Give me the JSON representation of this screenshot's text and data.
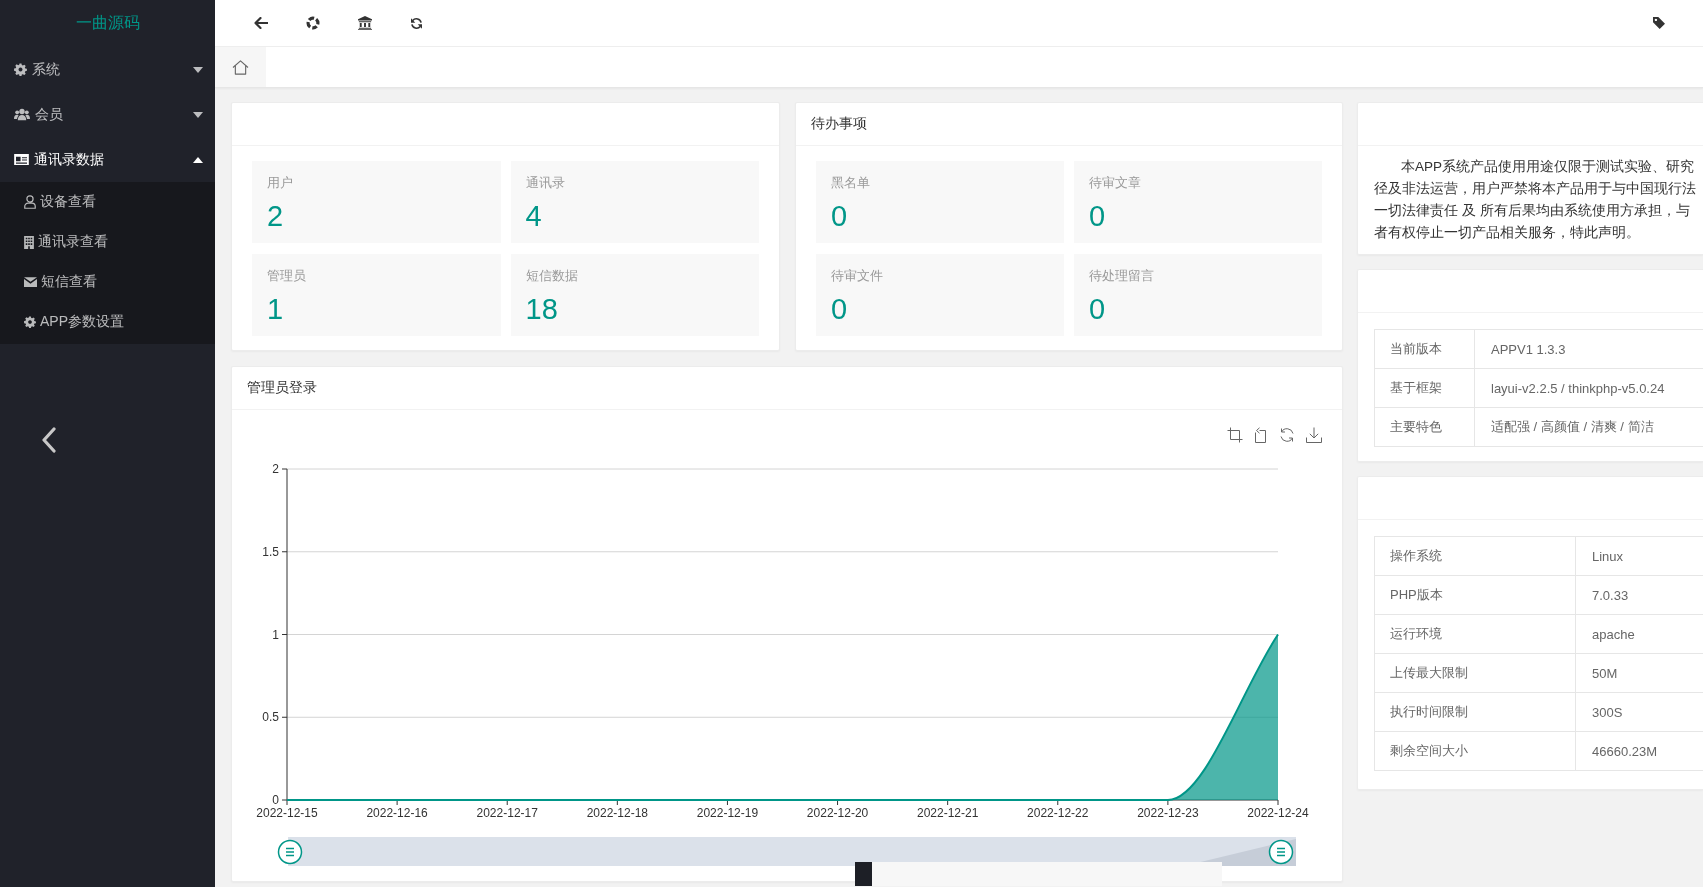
{
  "sidebar": {
    "logo": "一曲源码",
    "items": [
      {
        "label": "系统",
        "expanded": false
      },
      {
        "label": "会员",
        "expanded": false
      },
      {
        "label": "通讯录数据",
        "expanded": true,
        "children": [
          {
            "label": "设备查看"
          },
          {
            "label": "通讯录查看"
          },
          {
            "label": "短信查看"
          },
          {
            "label": "APP参数设置"
          }
        ]
      }
    ]
  },
  "overview": {
    "stats": [
      {
        "label": "用户",
        "value": "2"
      },
      {
        "label": "通讯录",
        "value": "4"
      },
      {
        "label": "管理员",
        "value": "1"
      },
      {
        "label": "短信数据",
        "value": "18"
      }
    ]
  },
  "todo": {
    "title": "待办事项",
    "stats": [
      {
        "label": "黑名单",
        "value": "0"
      },
      {
        "label": "待审文章",
        "value": "0"
      },
      {
        "label": "待审文件",
        "value": "0"
      },
      {
        "label": "待处理留言",
        "value": "0"
      }
    ]
  },
  "disclaimer": {
    "lines": [
      "本APP系统产品使用用途仅限于测试实验、研究",
      "径及非法运营，用户严禁将本产品用于与中国现行法",
      "一切法律责任 及 所有后果均由系统使用方承担，与",
      "者有权停止一切产品相关服务，特此声明。"
    ]
  },
  "version_info": {
    "rows": [
      {
        "label": "当前版本",
        "value": "APPV1 1.3.3"
      },
      {
        "label": "基于框架",
        "value": "layui-v2.2.5 / thinkphp-v5.0.24"
      },
      {
        "label": "主要特色",
        "value": "适配强 / 高颜值 / 清爽 / 简洁"
      }
    ]
  },
  "login_chart": {
    "title": "管理员登录",
    "chart_data": {
      "type": "area",
      "categories": [
        "2022-12-15",
        "2022-12-16",
        "2022-12-17",
        "2022-12-18",
        "2022-12-19",
        "2022-12-20",
        "2022-12-21",
        "2022-12-22",
        "2022-12-23",
        "2022-12-24"
      ],
      "series": [
        {
          "color": "#009688",
          "values": [
            0,
            0,
            0,
            0,
            0,
            0,
            0,
            0,
            0,
            1
          ]
        }
      ],
      "ylim": [
        0,
        2
      ],
      "yticks": [
        0,
        0.5,
        1,
        1.5,
        2
      ],
      "grid": true
    },
    "zoom_start": {
      "level": 0
    },
    "zoom_end": {
      "level": 1
    }
  },
  "server_info": {
    "rows": [
      {
        "label": "操作系统",
        "value": "Linux"
      },
      {
        "label": "PHP版本",
        "value": "7.0.33"
      },
      {
        "label": "运行环境",
        "value": "apache"
      },
      {
        "label": "上传最大限制",
        "value": "50M"
      },
      {
        "label": "执行时间限制",
        "value": "300S"
      },
      {
        "label": "剩余空间大小",
        "value": "46660.23M"
      }
    ]
  }
}
